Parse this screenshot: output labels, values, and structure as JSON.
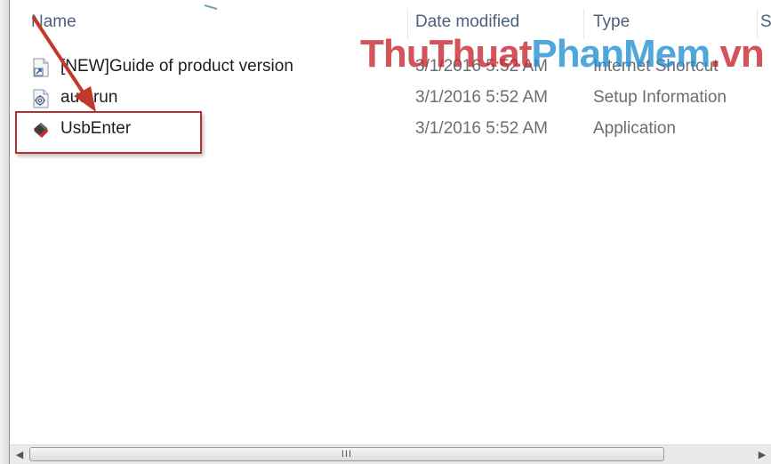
{
  "columns": {
    "name": "Name",
    "date": "Date modified",
    "type": "Type",
    "size": "S"
  },
  "files": [
    {
      "name": "[NEW]Guide of product version",
      "date": "3/1/2016 5:52 AM",
      "type": "Internet Shortcut",
      "icon": "internet-shortcut-icon"
    },
    {
      "name": "autorun",
      "date": "3/1/2016 5:52 AM",
      "type": "Setup Information",
      "icon": "setup-info-icon"
    },
    {
      "name": "UsbEnter",
      "date": "3/1/2016 5:52 AM",
      "type": "Application",
      "icon": "application-icon"
    }
  ],
  "watermark": {
    "part1": "ThuThuat",
    "part2": "PhanMem",
    "part3": ".vn"
  },
  "scrollbar": {
    "grip": "III",
    "left": "◀",
    "right": "▶"
  },
  "colors": {
    "highlight": "#b23234",
    "arrow": "#c0392b",
    "watermark_red": "#c8232c",
    "watermark_blue": "#1f8fd4"
  }
}
